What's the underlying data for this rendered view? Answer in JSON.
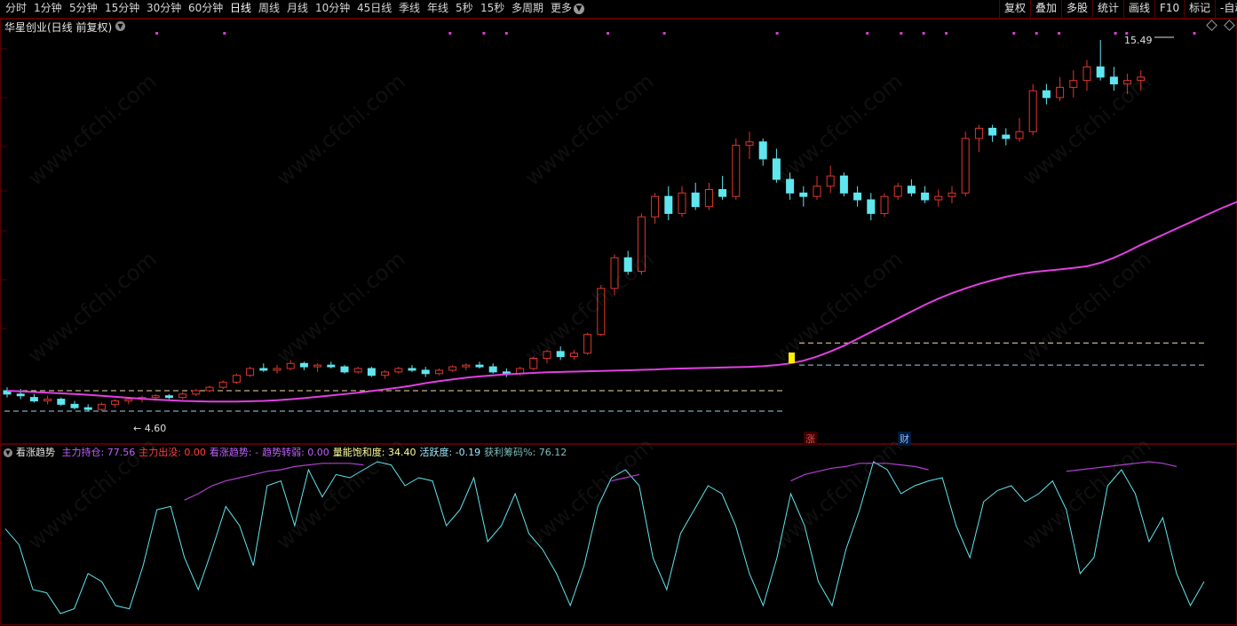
{
  "toolbar": {
    "periods": [
      "分时",
      "1分钟",
      "5分钟",
      "15分钟",
      "30分钟",
      "60分钟",
      "日线",
      "周线",
      "月线",
      "10分钟",
      "45日线",
      "季线",
      "年线",
      "5秒",
      "15秒",
      "多周期",
      "更多"
    ],
    "active_period": "日线",
    "tools": [
      "复权",
      "叠加",
      "多股",
      "统计",
      "画线",
      "F10",
      "标记",
      "-自动"
    ]
  },
  "chart_title": "华星创业(日线 前复权)",
  "price_marks": {
    "high": "15.49",
    "low": "4.60"
  },
  "event_labels": {
    "zhang": "涨",
    "cai": "财"
  },
  "indicator": {
    "name": "看涨趋势",
    "items": [
      {
        "label": "主力持仓:",
        "value": "77.56",
        "color": "#c060ff"
      },
      {
        "label": "主力出没:",
        "value": "0.00",
        "color": "#ff4040"
      },
      {
        "label": "看涨趋势:",
        "value": "-",
        "color": "#c060ff"
      },
      {
        "label": "趋势转弱:",
        "value": "0.00",
        "color": "#c060ff"
      },
      {
        "label": "量能饱和度:",
        "value": "34.40",
        "color": "#ffffa0"
      },
      {
        "label": "活跃度:",
        "value": "-0.19",
        "color": "#9fe8ff"
      },
      {
        "label": "获利筹码%:",
        "value": "76.12",
        "color": "#7fbfbf"
      }
    ]
  },
  "colors": {
    "up": "#e0362c",
    "down": "#5fe6ef",
    "ma": "#e040e0",
    "active": "#5fe6ef",
    "profit": "#b040d0"
  },
  "chart_data": {
    "type": "candlestick",
    "ma_values": [
      5.2,
      5.18,
      5.16,
      5.14,
      5.12,
      5.1,
      5.08,
      5.05,
      5.02,
      4.99,
      4.96,
      4.94,
      4.92,
      4.9,
      4.89,
      4.88,
      4.88,
      4.88,
      4.89,
      4.9,
      4.92,
      4.95,
      4.98,
      5.02,
      5.06,
      5.1,
      5.14,
      5.19,
      5.24,
      5.29,
      5.35,
      5.42,
      5.48,
      5.53,
      5.58,
      5.62,
      5.65,
      5.68,
      5.7,
      5.72,
      5.74,
      5.75,
      5.76,
      5.77,
      5.78,
      5.79,
      5.8,
      5.81,
      5.82,
      5.84,
      5.85,
      5.86,
      5.87,
      5.88,
      5.89,
      5.9,
      5.92,
      5.95,
      6.0,
      6.08,
      6.2,
      6.35,
      6.52,
      6.72,
      6.92,
      7.12,
      7.32,
      7.52,
      7.72,
      7.9,
      8.06,
      8.2,
      8.33,
      8.44,
      8.54,
      8.62,
      8.68,
      8.72,
      8.76,
      8.8,
      8.85,
      8.95,
      9.1,
      9.28,
      9.48,
      9.66,
      9.84,
      10.02,
      10.2,
      10.38,
      10.56,
      10.72,
      10.86
    ],
    "candles": [
      [
        5.2,
        5.3,
        5.0,
        5.1
      ],
      [
        5.1,
        5.25,
        4.95,
        5.05
      ],
      [
        5.0,
        5.1,
        4.85,
        4.9
      ],
      [
        4.9,
        5.05,
        4.8,
        4.95
      ],
      [
        4.95,
        5.0,
        4.75,
        4.8
      ],
      [
        4.8,
        4.9,
        4.65,
        4.7
      ],
      [
        4.7,
        4.8,
        4.6,
        4.65
      ],
      [
        4.65,
        4.85,
        4.6,
        4.8
      ],
      [
        4.8,
        4.95,
        4.7,
        4.9
      ],
      [
        4.9,
        5.0,
        4.8,
        4.95
      ],
      [
        4.95,
        5.05,
        4.85,
        5.0
      ],
      [
        5.0,
        5.1,
        4.9,
        5.05
      ],
      [
        5.05,
        5.1,
        4.95,
        5.0
      ],
      [
        5.0,
        5.15,
        4.95,
        5.1
      ],
      [
        5.1,
        5.25,
        5.05,
        5.2
      ],
      [
        5.2,
        5.35,
        5.15,
        5.3
      ],
      [
        5.3,
        5.5,
        5.25,
        5.45
      ],
      [
        5.45,
        5.7,
        5.4,
        5.65
      ],
      [
        5.65,
        5.9,
        5.6,
        5.85
      ],
      [
        5.85,
        6.0,
        5.75,
        5.8
      ],
      [
        5.8,
        5.95,
        5.7,
        5.85
      ],
      [
        5.85,
        6.1,
        5.8,
        6.0
      ],
      [
        6.0,
        6.05,
        5.8,
        5.9
      ],
      [
        5.9,
        6.0,
        5.75,
        5.95
      ],
      [
        5.95,
        6.05,
        5.85,
        5.9
      ],
      [
        5.9,
        5.95,
        5.7,
        5.75
      ],
      [
        5.75,
        5.9,
        5.7,
        5.85
      ],
      [
        5.85,
        5.9,
        5.6,
        5.65
      ],
      [
        5.65,
        5.8,
        5.55,
        5.75
      ],
      [
        5.75,
        5.9,
        5.7,
        5.85
      ],
      [
        5.85,
        5.95,
        5.75,
        5.8
      ],
      [
        5.8,
        5.9,
        5.6,
        5.7
      ],
      [
        5.7,
        5.85,
        5.65,
        5.8
      ],
      [
        5.8,
        5.95,
        5.75,
        5.9
      ],
      [
        5.9,
        6.0,
        5.8,
        5.95
      ],
      [
        5.95,
        6.05,
        5.85,
        5.9
      ],
      [
        5.9,
        6.0,
        5.7,
        5.75
      ],
      [
        5.75,
        5.85,
        5.6,
        5.7
      ],
      [
        5.7,
        5.9,
        5.65,
        5.85
      ],
      [
        5.85,
        6.2,
        5.8,
        6.15
      ],
      [
        6.15,
        6.4,
        6.0,
        6.35
      ],
      [
        6.35,
        6.5,
        6.1,
        6.2
      ],
      [
        6.2,
        6.4,
        6.1,
        6.3
      ],
      [
        6.3,
        6.9,
        6.25,
        6.85
      ],
      [
        6.85,
        8.3,
        6.8,
        8.2
      ],
      [
        8.2,
        9.2,
        8.0,
        9.1
      ],
      [
        9.1,
        9.3,
        8.6,
        8.7
      ],
      [
        8.7,
        10.4,
        8.6,
        10.3
      ],
      [
        10.3,
        11.0,
        10.1,
        10.9
      ],
      [
        10.9,
        11.2,
        10.2,
        10.4
      ],
      [
        10.4,
        11.2,
        10.3,
        11.0
      ],
      [
        11.0,
        11.3,
        10.5,
        10.6
      ],
      [
        10.6,
        11.3,
        10.5,
        11.1
      ],
      [
        11.1,
        11.5,
        10.8,
        10.9
      ],
      [
        10.9,
        12.6,
        10.8,
        12.4
      ],
      [
        12.4,
        12.8,
        12.0,
        12.5
      ],
      [
        12.5,
        12.6,
        11.8,
        12.0
      ],
      [
        12.0,
        12.3,
        11.3,
        11.4
      ],
      [
        11.4,
        11.6,
        10.8,
        11.0
      ],
      [
        11.0,
        11.2,
        10.6,
        10.9
      ],
      [
        10.9,
        11.5,
        10.8,
        11.2
      ],
      [
        11.2,
        11.8,
        11.0,
        11.5
      ],
      [
        11.5,
        11.6,
        10.9,
        11.0
      ],
      [
        11.0,
        11.2,
        10.6,
        10.8
      ],
      [
        10.8,
        11.0,
        10.2,
        10.4
      ],
      [
        10.4,
        11.0,
        10.3,
        10.9
      ],
      [
        10.9,
        11.3,
        10.8,
        11.2
      ],
      [
        11.2,
        11.4,
        10.9,
        11.0
      ],
      [
        11.0,
        11.2,
        10.7,
        10.8
      ],
      [
        10.8,
        11.1,
        10.6,
        10.9
      ],
      [
        10.9,
        11.2,
        10.7,
        11.0
      ],
      [
        11.0,
        12.8,
        10.9,
        12.6
      ],
      [
        12.6,
        13.0,
        12.2,
        12.9
      ],
      [
        12.9,
        13.0,
        12.5,
        12.7
      ],
      [
        12.7,
        12.9,
        12.4,
        12.6
      ],
      [
        12.6,
        13.2,
        12.5,
        12.8
      ],
      [
        12.8,
        14.2,
        12.7,
        14.0
      ],
      [
        14.0,
        14.2,
        13.6,
        13.8
      ],
      [
        13.8,
        14.4,
        13.7,
        14.1
      ],
      [
        14.1,
        14.6,
        13.8,
        14.3
      ],
      [
        14.3,
        14.9,
        14.0,
        14.7
      ],
      [
        14.7,
        15.49,
        14.3,
        14.4
      ],
      [
        14.4,
        14.7,
        14.0,
        14.2
      ],
      [
        14.2,
        14.5,
        13.9,
        14.3
      ],
      [
        14.3,
        14.6,
        14.0,
        14.4
      ]
    ],
    "indicator_series": {
      "active": [
        58,
        48,
        20,
        18,
        5,
        8,
        30,
        25,
        10,
        8,
        35,
        70,
        72,
        40,
        20,
        45,
        72,
        60,
        35,
        85,
        88,
        60,
        95,
        78,
        92,
        90,
        95,
        100,
        98,
        85,
        90,
        88,
        60,
        70,
        90,
        50,
        60,
        80,
        55,
        45,
        30,
        10,
        35,
        72,
        90,
        95,
        85,
        40,
        20,
        55,
        70,
        85,
        80,
        60,
        30,
        10,
        40,
        80,
        60,
        25,
        10,
        45,
        70,
        100,
        95,
        80,
        85,
        88,
        90,
        60,
        40,
        75,
        82,
        85,
        75,
        80,
        88,
        70,
        30,
        40,
        85,
        95,
        80,
        50,
        65,
        30,
        10,
        25
      ],
      "profit": [
        null,
        null,
        null,
        null,
        null,
        null,
        null,
        null,
        null,
        null,
        null,
        null,
        null,
        76,
        80,
        85,
        88,
        90,
        92,
        94,
        95,
        97,
        98,
        99,
        99,
        99,
        98,
        null,
        null,
        null,
        null,
        null,
        null,
        null,
        null,
        null,
        null,
        null,
        null,
        null,
        null,
        null,
        null,
        null,
        88,
        90,
        92,
        null,
        null,
        null,
        null,
        null,
        null,
        null,
        null,
        null,
        null,
        88,
        92,
        94,
        96,
        97,
        99,
        99,
        99,
        98,
        97,
        95,
        null,
        null,
        null,
        null,
        null,
        null,
        null,
        null,
        null,
        94,
        95,
        96,
        97,
        98,
        99,
        100,
        99,
        97,
        null,
        null
      ]
    }
  }
}
